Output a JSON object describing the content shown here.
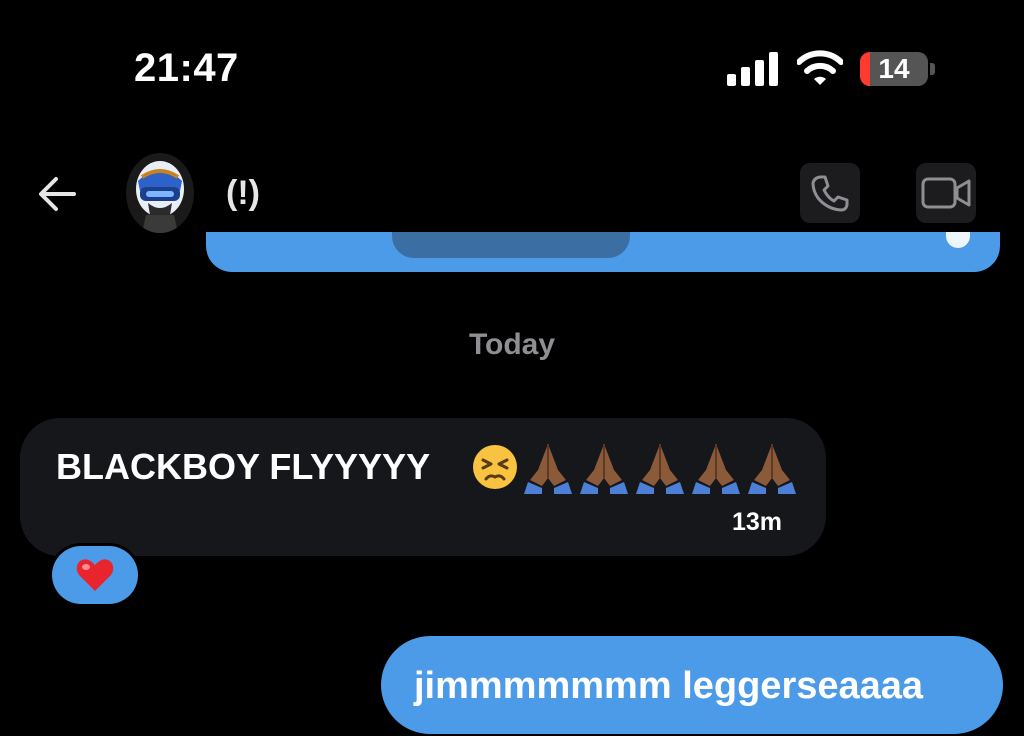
{
  "status_bar": {
    "time": "21:47",
    "battery_level": "14",
    "battery_color": "#ff3b30"
  },
  "header": {
    "back_icon": "arrow-left-icon",
    "chat_name": "(!)",
    "call_icon": "phone-icon",
    "video_icon": "video-camera-icon"
  },
  "messages": {
    "date_separator": "Today",
    "incoming": {
      "text": "BLACKBOY FLYYYYY",
      "emojis": [
        "persevering-face-emoji",
        "folded-hands-emoji",
        "folded-hands-emoji",
        "folded-hands-emoji",
        "folded-hands-emoji",
        "folded-hands-emoji"
      ],
      "time": "13m",
      "reaction": "red-heart-emoji"
    },
    "outgoing": {
      "text": "jimmmmmmm leggerseaaaa"
    }
  },
  "colors": {
    "background": "#000000",
    "outgoing_bubble": "#4c9be8",
    "incoming_bubble": "#16171a",
    "muted_text": "#8e8e93"
  }
}
